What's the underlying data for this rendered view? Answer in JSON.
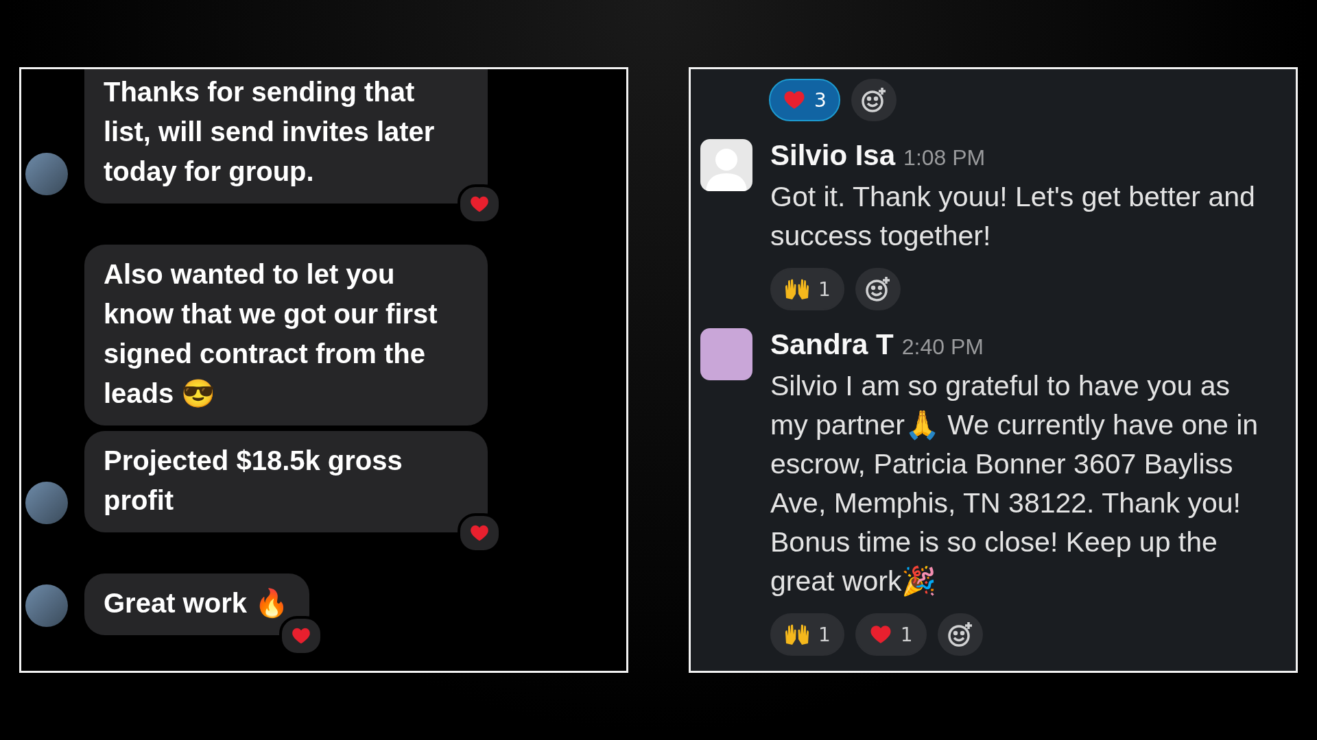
{
  "left_chat": {
    "groups": [
      {
        "bubbles": [
          {
            "text": "Thanks for sending that list, will send invites later today for group.",
            "hearted": true
          }
        ]
      },
      {
        "bubbles": [
          {
            "text": "Also wanted to let you know that we got our first signed contract from the leads 😎",
            "hearted": false
          },
          {
            "text": "Projected $18.5k gross profit",
            "hearted": true
          }
        ]
      },
      {
        "bubbles": [
          {
            "text": "Great work 🔥",
            "hearted": true
          }
        ]
      }
    ]
  },
  "right_chat": {
    "top_reactions": [
      {
        "kind": "heart",
        "count": "3",
        "selected": true
      }
    ],
    "messages": [
      {
        "name": "Silvio Isa",
        "time": "1:08 PM",
        "has_photo": false,
        "text": "Got it. Thank youu! Let's get better and success together!",
        "reactions": [
          {
            "kind": "hands",
            "count": "1",
            "selected": false
          }
        ]
      },
      {
        "name": "Sandra T",
        "time": "2:40 PM",
        "has_photo": true,
        "text": "Silvio I am so grateful to have you as my partner🙏  We currently have one in escrow, Patricia Bonner 3607 Bayliss Ave, Memphis, TN 38122. Thank you! Bonus time is so close! Keep up the great work🎉",
        "reactions": [
          {
            "kind": "hands",
            "count": "1",
            "selected": false
          },
          {
            "kind": "heart",
            "count": "1",
            "selected": false
          }
        ]
      }
    ]
  }
}
